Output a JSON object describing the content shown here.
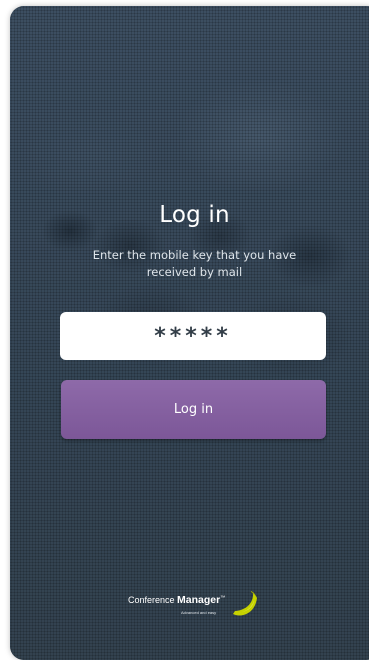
{
  "login": {
    "title": "Log in",
    "instructions": "Enter the mobile key that you have received by mail",
    "key_field_value": "*****",
    "button_label": "Log in"
  },
  "branding": {
    "name_prefix": "Conference",
    "name_main": "Manager",
    "trademark": "™",
    "tagline": "Advanced and easy",
    "logo_mark_icon": "banana-swoosh-logo-icon",
    "logo_mark_color": "#c6d200"
  },
  "colors": {
    "background": "#354657",
    "button": "#85619f",
    "input_background": "#ffffff"
  }
}
